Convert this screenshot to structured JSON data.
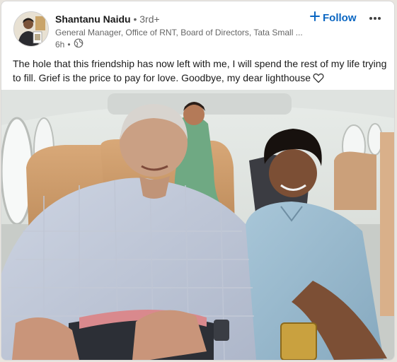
{
  "post": {
    "author_name": "Shantanu Naidu",
    "separator": "•",
    "connection_degree": "3rd+",
    "headline": "General Manager, Office of RNT, Board of Directors, Tata Small ...",
    "time_ago": "6h",
    "meta_separator": "•",
    "visibility_icon": "globe-icon",
    "follow_label": "Follow",
    "follow_icon": "plus-icon",
    "more_icon": "ellipsis-icon",
    "text": "The hole that this friendship has now left with me, I will spend the rest of my life trying to fill. Grief is the price to pay for love. Goodbye, my dear lighthouse",
    "text_emoji_icon": "white-heart-icon"
  },
  "colors": {
    "accent": "#0a66c2",
    "primary_text": "#000000e6",
    "secondary_text": "#666666"
  }
}
